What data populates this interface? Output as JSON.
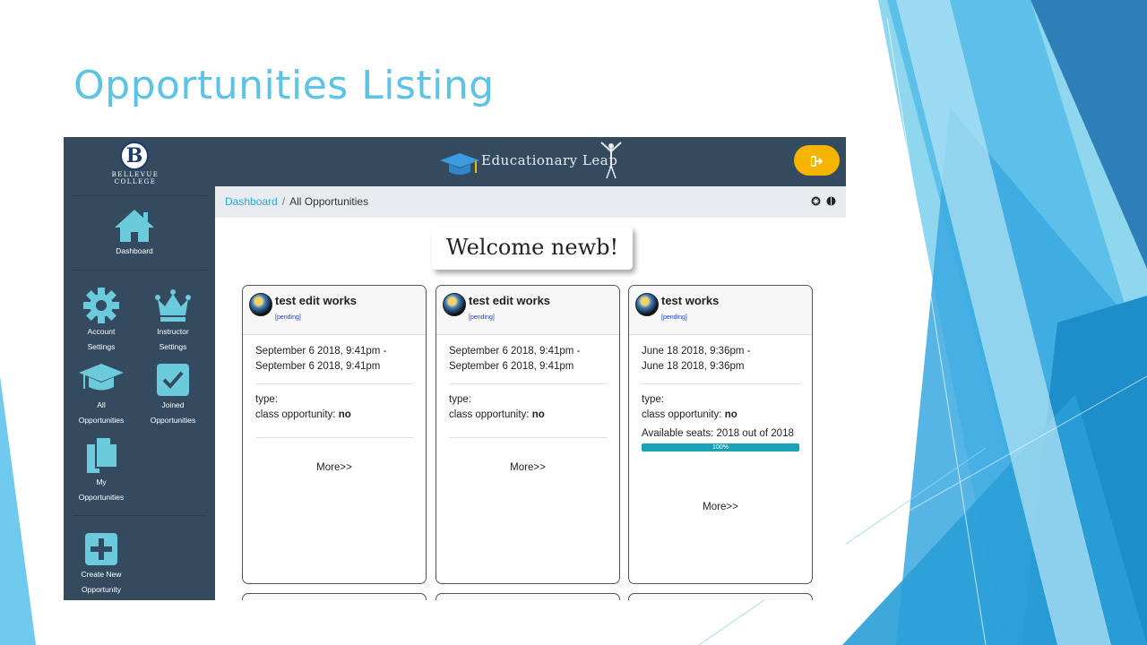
{
  "slide": {
    "title": "Opportunities Listing"
  },
  "app": {
    "logo": {
      "letter": "B",
      "name_line1": "BELLEVUE",
      "name_line2": "COLLEGE"
    },
    "brand": "Educationary Leap",
    "logout_icon": "sign-out-icon",
    "colors": {
      "navbar": "#334a5f",
      "accent": "#5bc3e6",
      "logout": "#f4b400",
      "progress": "#17a2b8"
    },
    "sidebar": {
      "dashboard": "Dashboard",
      "account_settings_1": "Account",
      "account_settings_2": "Settings",
      "instructor_settings_1": "Instructor",
      "instructor_settings_2": "Settings",
      "all_opps_1": "All",
      "all_opps_2": "Opportunities",
      "joined_opps_1": "Joined",
      "joined_opps_2": "Opportunities",
      "my_opps_1": "My",
      "my_opps_2": "Opportunities",
      "create_new_1": "Create New",
      "create_new_2": "Opportunity"
    },
    "breadcrumb": {
      "home": "Dashboard",
      "separator": "/",
      "current": "All Opportunities"
    },
    "welcome": "Welcome newb!",
    "cards": [
      {
        "title": "test edit works",
        "status": "[pending]",
        "date_start": "September 6 2018, 9:41pm -",
        "date_end": "September 6 2018, 9:41pm",
        "type": "type:",
        "class_label": "class opportunity:",
        "class_value": "no",
        "more": "More>>"
      },
      {
        "title": "test edit works",
        "status": "[pending]",
        "date_start": "September 6 2018, 9:41pm -",
        "date_end": "September 6 2018, 9:41pm",
        "type": "type:",
        "class_label": "class opportunity:",
        "class_value": "no",
        "more": "More>>"
      },
      {
        "title": "test works",
        "status": "[pending]",
        "date_start": "June 18 2018, 9:36pm -",
        "date_end": "June 18 2018, 9:36pm",
        "type": "type:",
        "class_label": "class opportunity:",
        "class_value": "no",
        "seats": "Available seats: 2018 out of 2018",
        "progress_label": "100%",
        "progress": 1.0,
        "more": "More>>"
      }
    ]
  }
}
